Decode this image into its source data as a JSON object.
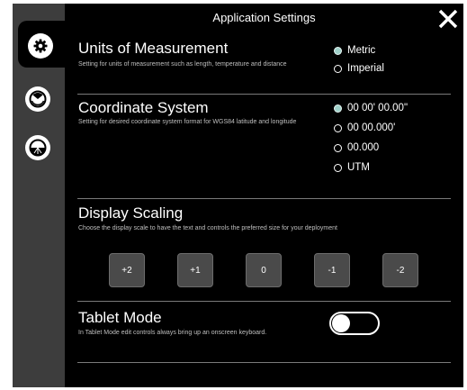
{
  "header": {
    "title": "Application Settings"
  },
  "units": {
    "title": "Units of Measurement",
    "description": "Setting for units of measurement such as length, temperature and distance",
    "options": [
      {
        "label": "Metric",
        "selected": true
      },
      {
        "label": "Imperial",
        "selected": false
      }
    ]
  },
  "coordinates": {
    "title": "Coordinate System",
    "description": "Setting for desired coordinate system format for WGS84 latitude and longitude",
    "options": [
      {
        "label": "00 00' 00.00\"",
        "selected": true
      },
      {
        "label": "00 00.000'",
        "selected": false
      },
      {
        "label": "00.000",
        "selected": false
      },
      {
        "label": "UTM",
        "selected": false
      }
    ]
  },
  "scaling": {
    "title": "Display Scaling",
    "description": "Choose the display scale to have the text and controls the preferred size for your deployment",
    "buttons": [
      "+2",
      "+1",
      "0",
      "-1",
      "-2"
    ]
  },
  "tablet": {
    "title": "Tablet Mode",
    "description": "In Tablet Mode edit controls always bring up an onscreen keyboard.",
    "enabled": false
  },
  "sidebar": {
    "items": [
      {
        "icon": "gear-icon",
        "active": true
      },
      {
        "icon": "gauge-icon",
        "active": false
      },
      {
        "icon": "horizon-icon",
        "active": false
      }
    ]
  },
  "colors": {
    "background": "#000000",
    "sidebar": "#3d3d3d",
    "selected_radio": "#9fd0c9",
    "button": "#4a4a4a"
  }
}
